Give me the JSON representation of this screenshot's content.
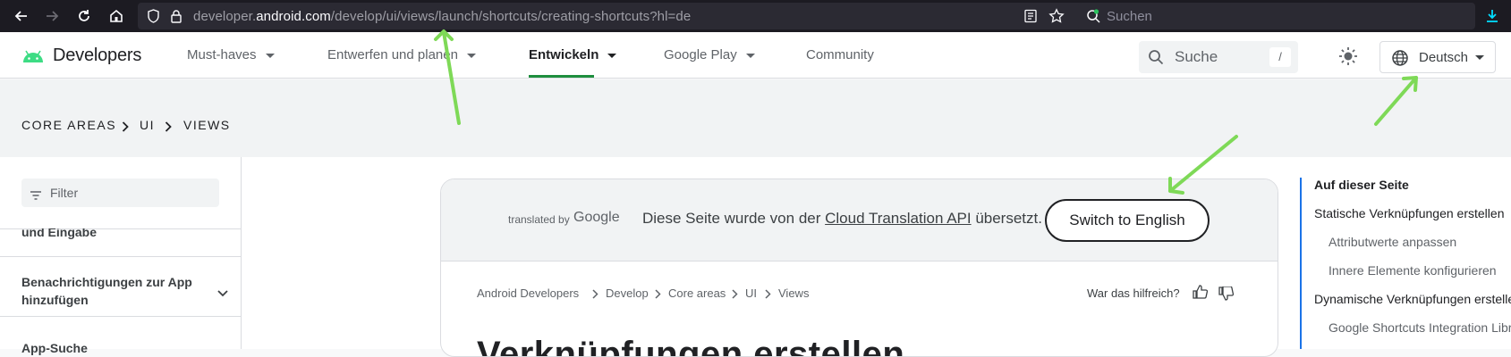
{
  "browser": {
    "url_prefix": "developer.",
    "url_domain": "android.com",
    "url_path": "/develop/ui/views/launch/shortcuts/creating-shortcuts?hl=de",
    "search_placeholder": "Suchen"
  },
  "header": {
    "logo_text": "Developers",
    "nav": [
      {
        "label": "Must-haves"
      },
      {
        "label": "Entwerfen und planen"
      },
      {
        "label": "Entwickeln"
      },
      {
        "label": "Google Play"
      },
      {
        "label": "Community"
      }
    ],
    "search_placeholder": "Suche",
    "search_shortcut": "/",
    "language": "Deutsch"
  },
  "breadcrumb": [
    "CORE AREAS",
    "UI",
    "VIEWS"
  ],
  "sidebar": {
    "filter_placeholder": "Filter",
    "items": [
      {
        "label": "und Eingabe"
      },
      {
        "label": "Benachrichtigungen zur App hinzufügen"
      },
      {
        "label": "App-Suche"
      }
    ]
  },
  "translation_bar": {
    "translated_by": "translated by",
    "google": "Google",
    "message_before": "Diese Seite wurde von der ",
    "link": "Cloud Translation API",
    "message_after": " übersetzt.",
    "switch_button": "Switch to English"
  },
  "content": {
    "crumbs": [
      "Android Developers",
      "Develop",
      "Core areas",
      "UI",
      "Views"
    ],
    "helpful_label": "War das hilfreich?",
    "title_partial": "Verknüpfungen erstellen"
  },
  "toc": {
    "heading": "Auf dieser Seite",
    "items": [
      {
        "label": "Statische Verknüpfungen erstellen"
      },
      {
        "label": "Attributwerte anpassen"
      },
      {
        "label": "Innere Elemente konfigurieren"
      },
      {
        "label": "Dynamische Verknüpfungen erstellen"
      },
      {
        "label": "Google Shortcuts Integration Library"
      }
    ]
  },
  "colors": {
    "accent_green": "#1e8e3e",
    "toc_rail": "#1a73e8",
    "annotation_arrow": "#7ed957",
    "browser_bg": "#1c1b22"
  }
}
